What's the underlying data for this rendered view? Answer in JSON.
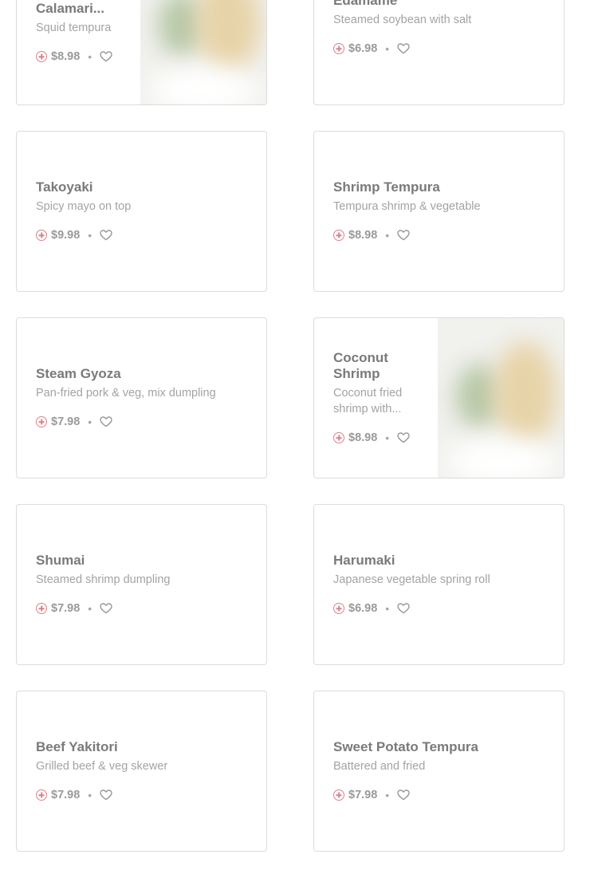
{
  "colors": {
    "accent": "#d9828a",
    "title": "#7a7a7a",
    "description": "#a3a3a3",
    "border": "#dcdcdc"
  },
  "icons": {
    "add": "plus-circle-icon",
    "favorite": "heart-icon",
    "image": "food-photo"
  },
  "separator": "•",
  "menu_items": [
    {
      "name": "Calamari...",
      "description": "Squid tempura",
      "price": "$8.98",
      "has_image": true
    },
    {
      "name": "Edamame",
      "description": "Steamed soybean with salt",
      "price": "$6.98",
      "has_image": false
    },
    {
      "name": "Takoyaki",
      "description": "Spicy mayo on top",
      "price": "$9.98",
      "has_image": false
    },
    {
      "name": "Shrimp Tempura",
      "description": "Tempura shrimp & vegetable",
      "price": "$8.98",
      "has_image": false
    },
    {
      "name": "Steam Gyoza",
      "description": "Pan-fried pork & veg, mix dumpling",
      "price": "$7.98",
      "has_image": false
    },
    {
      "name": "Coconut Shrimp",
      "description": "Coconut fried shrimp with...",
      "price": "$8.98",
      "has_image": true
    },
    {
      "name": "Shumai",
      "description": "Steamed shrimp dumpling",
      "price": "$7.98",
      "has_image": false
    },
    {
      "name": "Harumaki",
      "description": "Japanese vegetable spring roll",
      "price": "$6.98",
      "has_image": false
    },
    {
      "name": "Beef Yakitori",
      "description": "Grilled beef & veg skewer",
      "price": "$7.98",
      "has_image": false
    },
    {
      "name": "Sweet Potato Tempura",
      "description": "Battered and fried",
      "price": "$7.98",
      "has_image": false
    }
  ]
}
